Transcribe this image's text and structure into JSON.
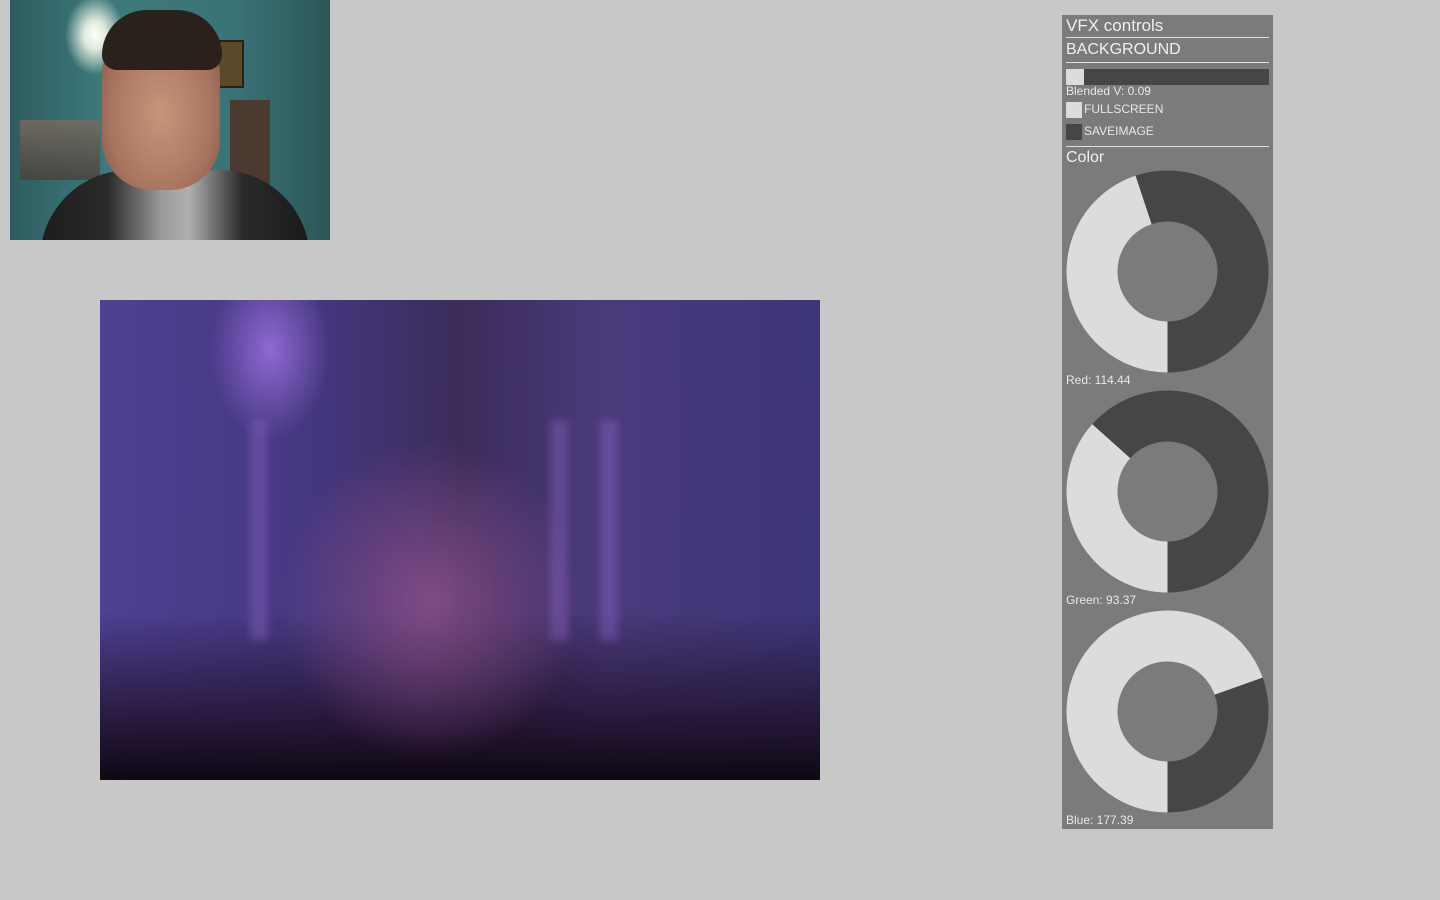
{
  "panel": {
    "title": "VFX controls",
    "group": "BACKGROUND",
    "blended": {
      "label": "Blended V: 0.09",
      "value": 0.09
    },
    "fullscreen": {
      "label": "FULLSCREEN",
      "checked": true
    },
    "saveimage": {
      "label": "SAVEIMAGE",
      "checked": false
    },
    "color_section": "Color",
    "red": {
      "label": "Red: 114.44",
      "value": 114.44,
      "max": 255
    },
    "green": {
      "label": "Green: 93.37",
      "value": 93.37,
      "max": 255
    },
    "blue": {
      "label": "Blue: 177.39",
      "value": 177.39,
      "max": 255
    }
  },
  "colors": {
    "background": "#c8c8c8",
    "panel": "#7b7b7b",
    "active": "#dcdcdc",
    "inactive": "#464646"
  }
}
